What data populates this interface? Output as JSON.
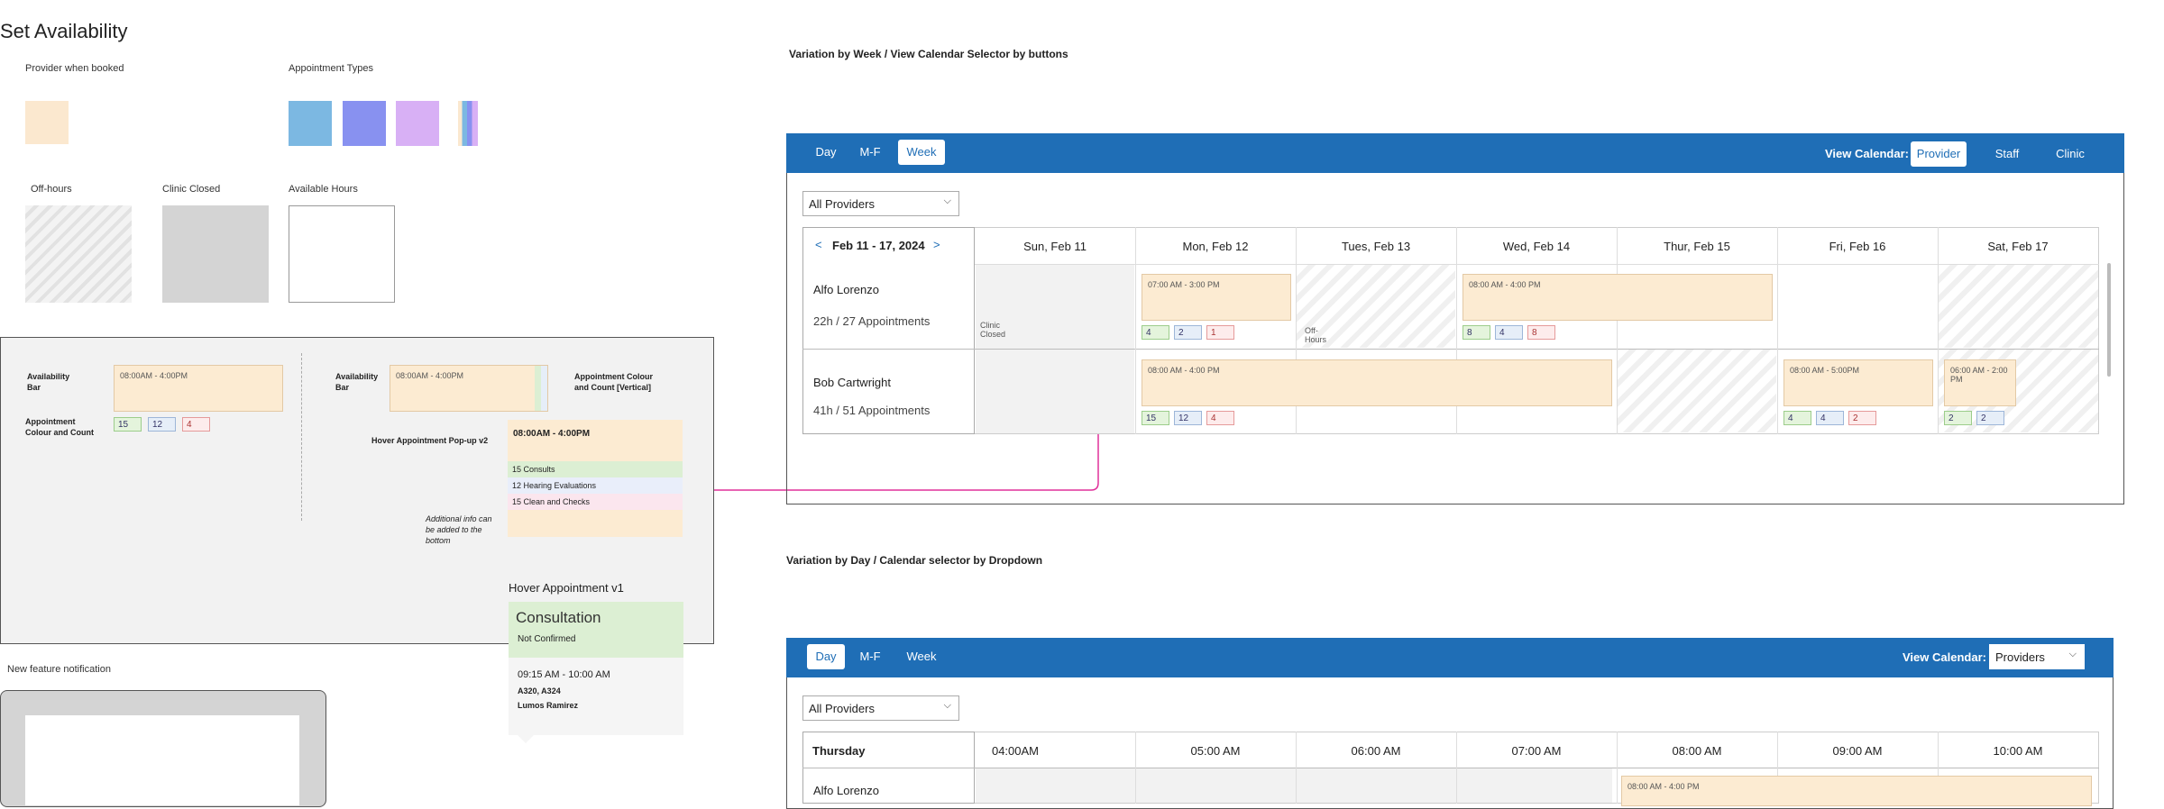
{
  "page_title": "Set Availability",
  "legend": {
    "provider_when_booked": "Provider when booked",
    "appointment_types": "Appointment Types",
    "off_hours": "Off-hours",
    "clinic_closed": "Clinic Closed",
    "available_hours": "Available Hours",
    "colors": {
      "booked": "#fbe8cf",
      "type1": "#7cb8e2",
      "type2": "#8891f0",
      "type3": "#d8b0f5"
    }
  },
  "panel": {
    "availability_bar_label": "Availability Bar",
    "bar_time": "08:00AM - 4:00PM",
    "appt_colour_count_label": "Appointment Colour and Count",
    "counts": [
      "15",
      "12",
      "4"
    ],
    "availability_bar_label2": "Availability Bar",
    "bar_time2": "08:00AM - 4:00PM",
    "appt_colour_count_vertical": "Appointment Colour and Count [Vertical]",
    "hover_v2_label": "Hover Appointment Pop-up v2",
    "popup_time": "08:00AM - 4:00PM",
    "popup_rows": [
      "15 Consults",
      "12 Hearing Evaluations",
      "15 Clean and Checks"
    ],
    "additional_info": "Additional info can be added to the bottom",
    "hover_v1_label": "Hover Appointment v1",
    "v1_title": "Consultation",
    "v1_status": "Not Confirmed",
    "v1_time": "09:15 AM - 10:00 AM",
    "v1_rooms": "A320, A324",
    "v1_person": "Lumos Ramirez"
  },
  "new_feature": "New feature notification",
  "week_section": {
    "heading": "Variation by Week / View Calendar Selector by buttons",
    "tabs": [
      "Day",
      "M-F",
      "Week"
    ],
    "active_tab": "Week",
    "view_calendar_label": "View Calendar:",
    "view_buttons": [
      "Provider",
      "Staff",
      "Clinic"
    ],
    "active_view": "Provider",
    "dropdown": "All Providers",
    "range": "Feb 11 - 17, 2024",
    "days": [
      "Sun, Feb 11",
      "Mon, Feb 12",
      "Tues, Feb 13",
      "Wed, Feb 14",
      "Thur, Feb 15",
      "Fri, Feb 16",
      "Sat, Feb 17"
    ],
    "providers": [
      {
        "name": "Alfo Lorenzo",
        "summary": "22h / 27 Appointments"
      },
      {
        "name": "Bob Cartwright",
        "summary": "41h / 51 Appointments"
      }
    ],
    "clinic_closed": "Clinic Closed",
    "off_hours": "Off- Hours",
    "bars": {
      "a_mon": "07:00 AM - 3:00 PM",
      "a_wed": "08:00 AM - 4:00 PM",
      "b_mon": "08:00 AM - 4:00 PM",
      "b_fri": "08:00 AM - 5:00PM",
      "b_sat": "06:00 AM - 2:00 PM"
    },
    "counts": {
      "a_mon": [
        "4",
        "2",
        "1"
      ],
      "a_wed": [
        "8",
        "4",
        "8"
      ],
      "b_mon": [
        "15",
        "12",
        "4"
      ],
      "b_fri": [
        "4",
        "4",
        "2"
      ],
      "b_sat": [
        "2",
        "2"
      ]
    }
  },
  "day_section": {
    "heading": "Variation by Day / Calendar selector by Dropdown",
    "tabs": [
      "Day",
      "M-F",
      "Week"
    ],
    "active_tab": "Day",
    "view_calendar_label": "View Calendar:",
    "view_dropdown": "Providers",
    "dropdown": "All Providers",
    "day": "Thursday",
    "times": [
      "04:00AM",
      "05:00 AM",
      "06:00 AM",
      "07:00 AM",
      "08:00 AM",
      "09:00 AM",
      "10:00 AM"
    ],
    "provider": "Alfo Lorenzo",
    "bar": "08:00 AM - 4:00 PM"
  },
  "accent": "#1f6eb6",
  "arrow_color": "#e0309a"
}
